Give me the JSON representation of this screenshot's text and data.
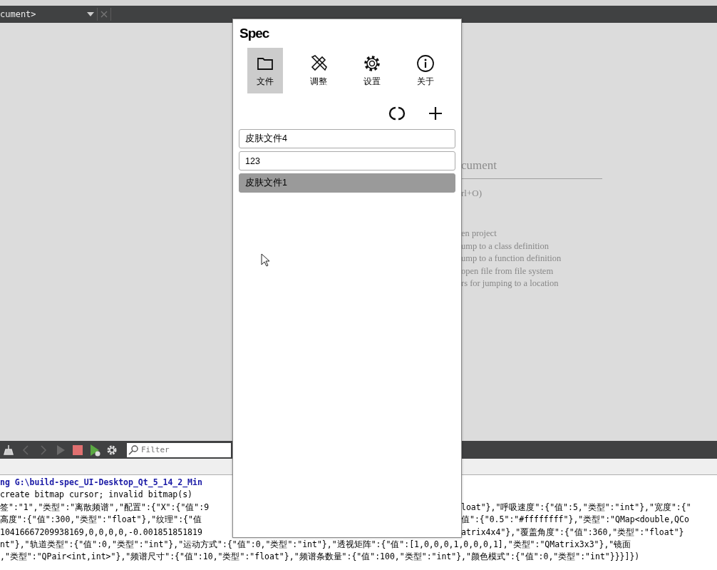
{
  "editor": {
    "tab_label": "cument>",
    "welcome_heading": "cument",
    "shortcut": "rl+O)",
    "hints": [
      "en project",
      "ump to a class definition",
      "ump to a function definition",
      "open file from file system",
      "rs for jumping to a location"
    ]
  },
  "output_panel": {
    "filter": {
      "placeholder": "Filter"
    },
    "lines": [
      {
        "kind": "link",
        "text": "ng G:\\build-spec_UI-Desktop_Qt_5_14_2_Min"
      },
      {
        "kind": "plain",
        "text": "create bitmap cursor; invalid bitmap(s)"
      },
      {
        "kind": "split",
        "left": "签\":\"1\",\"类型\":\"离散频谱\",\"配置\":{\"X\":{\"值\":9",
        "right": "loat\"},\"呼吸速度\":{\"值\":5,\"类型\":\"int\"},\"宽度\":{\""
      },
      {
        "kind": "split",
        "left": "高度\":{\"值\":300,\"类型\":\"float\"},\"纹理\":{\"值",
        "right": "值\":{\"0.5\":\"#ffffffff\"},\"类型\":\"QMap<double,QCo"
      },
      {
        "kind": "split",
        "left": "10416667209938169,0,0,0,0,-0.001851851819",
        "right": "atrix4x4\"},\"覆盖角度\":{\"值\":360,\"类型\":\"float\"}"
      },
      {
        "kind": "plain",
        "text": "nt\"},\"轨道类型\":{\"值\":0,\"类型\":\"int\"},\"运动方式\":{\"值\":0,\"类型\":\"int\"},\"透视矩阵\":{\"值\":[1,0,0,0,1,0,0,0,1],\"类型\":\"QMatrix3x3\"},\"镜面"
      },
      {
        "kind": "plain",
        "text": ",\"类型\":\"QPair<int,int>\"},\"频谱尺寸\":{\"值\":10,\"类型\":\"float\"},\"频谱条数量\":{\"值\":100,\"类型\":\"int\"},\"颜色模式\":{\"值\":0,\"类型\":\"int\"}}}]})"
      }
    ]
  },
  "window": {
    "title": "Spec",
    "tabs": [
      {
        "kind": "folder",
        "label": "文件",
        "selected": true
      },
      {
        "kind": "tools",
        "label": "调整",
        "selected": false
      },
      {
        "kind": "gear",
        "label": "设置",
        "selected": false
      },
      {
        "kind": "info",
        "label": "关于",
        "selected": false
      }
    ],
    "files": [
      {
        "label": "皮肤文件4",
        "selected": false
      },
      {
        "label": "123",
        "selected": false
      },
      {
        "label": "皮肤文件1",
        "selected": true
      }
    ]
  }
}
